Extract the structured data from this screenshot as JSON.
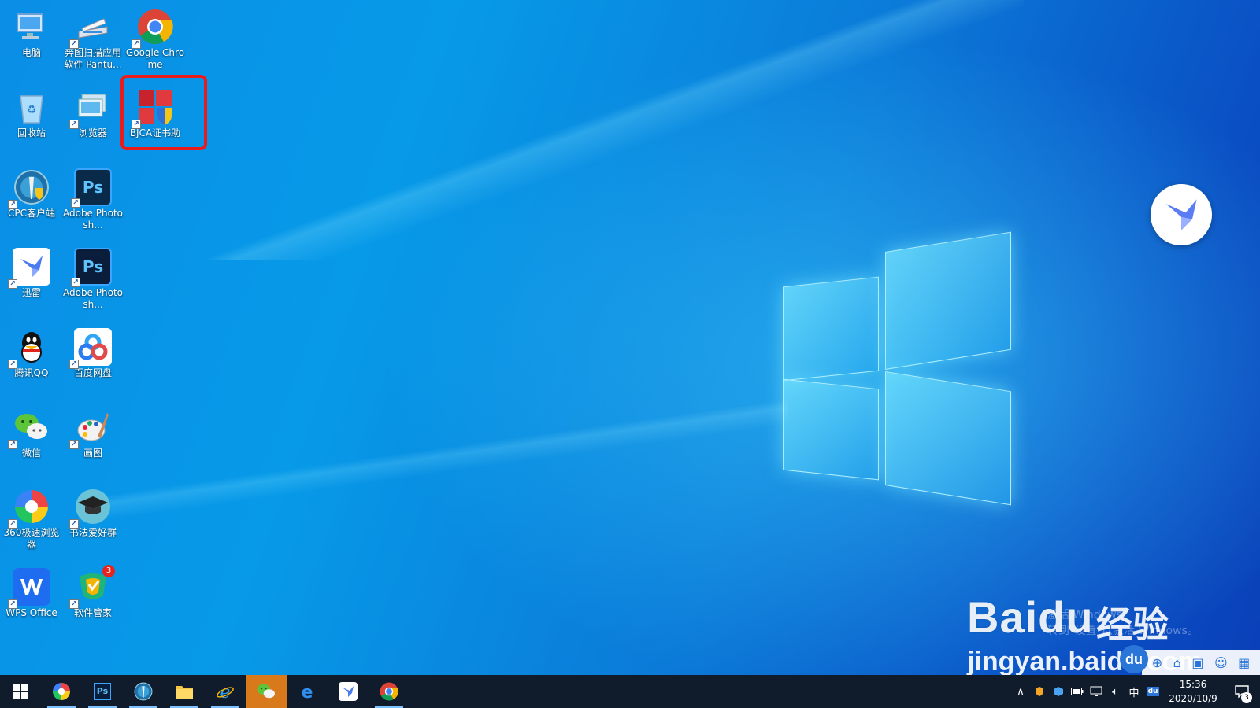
{
  "desktop": {
    "icons": [
      {
        "label": "电脑",
        "icon": "computer-icon"
      },
      {
        "label": "奔图扫描应用软件 Pantu...",
        "icon": "scanner-icon"
      },
      {
        "label": "Google Chrome",
        "icon": "chrome-icon"
      },
      {
        "label": "回收站",
        "icon": "recycle-bin-icon"
      },
      {
        "label": "浏览器",
        "icon": "browser-icon"
      },
      {
        "label": "BJCA证书助",
        "icon": "bjca-certificate-icon"
      },
      {
        "label": "CPC客户端",
        "icon": "cpc-client-icon"
      },
      {
        "label": "Adobe Photosh...",
        "icon": "photoshop-icon"
      },
      {
        "label": "迅雷",
        "icon": "thunder-icon"
      },
      {
        "label": "Adobe Photosh...",
        "icon": "photoshop-icon"
      },
      {
        "label": "腾讯QQ",
        "icon": "qq-icon"
      },
      {
        "label": "百度网盘",
        "icon": "baidu-netdisk-icon"
      },
      {
        "label": "微信",
        "icon": "wechat-icon"
      },
      {
        "label": "画图",
        "icon": "paint-icon"
      },
      {
        "label": "360极速浏览器",
        "icon": "360-browser-icon"
      },
      {
        "label": "书法爱好群",
        "icon": "calligraphy-group-icon"
      },
      {
        "label": "WPS Office",
        "icon": "wps-office-icon"
      },
      {
        "label": "软件管家",
        "icon": "software-manager-icon"
      }
    ],
    "software_manager_badge": "3"
  },
  "watermark": {
    "ghost_line1": "激活 Windows",
    "ghost_line2": "转到\"设置\"以激活 Windows。",
    "brand": "Baidu",
    "brand_suffix": "经验",
    "url": "jingyan.baidu.com",
    "du": "du"
  },
  "taskbar": {
    "apps": [
      {
        "icon": "windows-start-icon"
      },
      {
        "icon": "360-browser-icon"
      },
      {
        "icon": "photoshop-icon",
        "text": "Ps"
      },
      {
        "icon": "cpc-client-icon"
      },
      {
        "icon": "file-explorer-icon"
      },
      {
        "icon": "internet-explorer-icon"
      },
      {
        "icon": "wechat-icon"
      },
      {
        "icon": "edge-icon"
      },
      {
        "icon": "thunder-icon"
      },
      {
        "icon": "chrome-icon"
      }
    ],
    "tray": {
      "ime": "中",
      "time": "15:36",
      "date": "2020/10/9",
      "notification_count": "3"
    }
  },
  "colors": {
    "highlight": "#e81c1c",
    "taskbar": "#101c2c",
    "active_app": "#d8791c"
  }
}
